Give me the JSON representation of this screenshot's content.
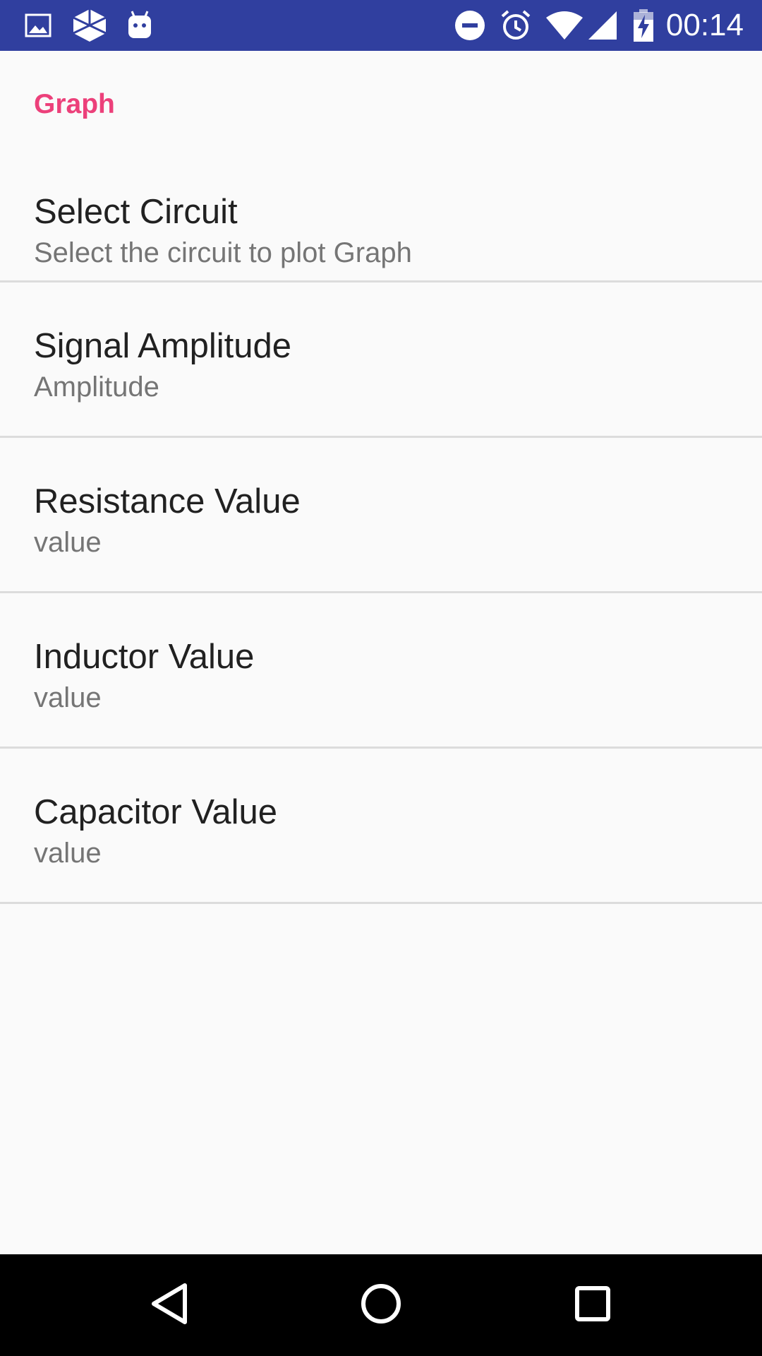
{
  "status_bar": {
    "time": "00:14",
    "left_icons": [
      "image-icon",
      "app-diamond-icon",
      "android-icon"
    ],
    "right_icons": [
      "do-not-disturb-icon",
      "alarm-icon",
      "wifi-icon",
      "signal-icon",
      "battery-charging-icon"
    ],
    "background_color": "#303f9f"
  },
  "settings": {
    "category_title": "Graph",
    "category_color": "#ec407a",
    "items": [
      {
        "title": "Select Circuit",
        "summary": "Select the circuit to plot Graph"
      },
      {
        "title": "Signal Amplitude",
        "summary": "Amplitude"
      },
      {
        "title": "Resistance Value",
        "summary": "value"
      },
      {
        "title": "Inductor Value",
        "summary": "value"
      },
      {
        "title": "Capacitor Value",
        "summary": "value"
      }
    ]
  },
  "nav_bar": {
    "buttons": [
      "back-icon",
      "home-icon",
      "recents-icon"
    ]
  }
}
